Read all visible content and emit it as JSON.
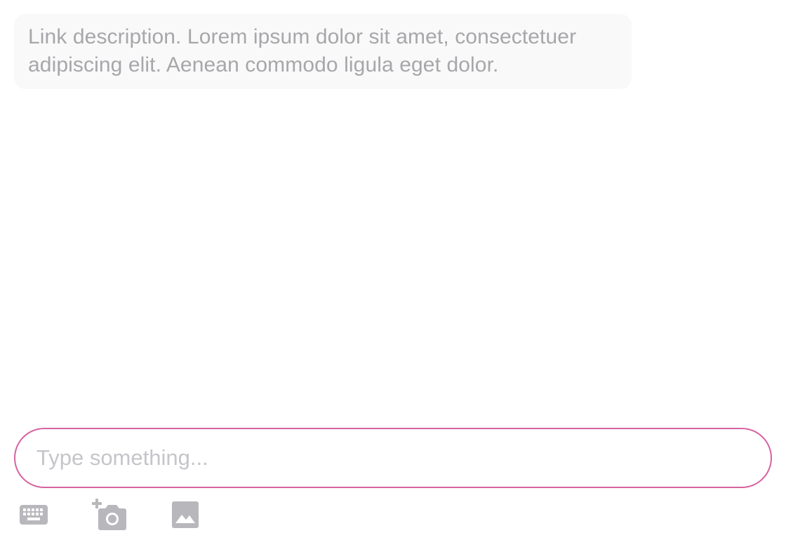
{
  "message": {
    "text": "Link description. Lorem ipsum dolor sit amet, consectetuer adipiscing elit. Aenean commodo ligula eget dolor."
  },
  "composer": {
    "placeholder": "Type something...",
    "value": ""
  },
  "toolbar": {
    "items": [
      {
        "icon": "keyboard-icon"
      },
      {
        "icon": "add-photo-camera-icon"
      },
      {
        "icon": "image-icon"
      }
    ]
  },
  "colors": {
    "accent": "#d7629f",
    "bubble_bg": "#f9f9f9",
    "text_muted": "#a7a7ab",
    "icon": "#b8b8bc"
  }
}
